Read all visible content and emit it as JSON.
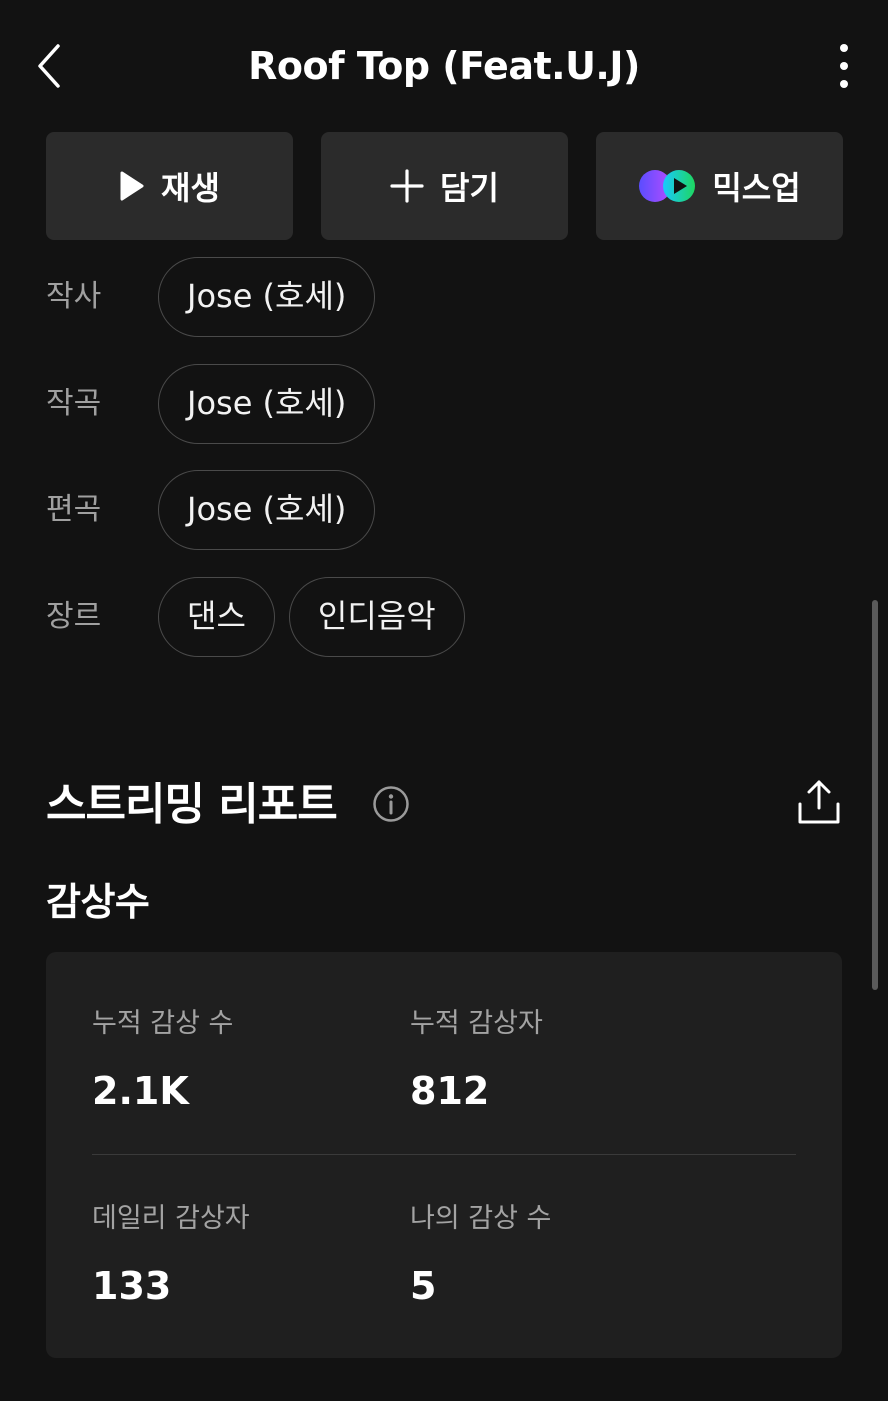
{
  "header": {
    "title": "Roof Top (Feat.U.J)",
    "back_icon": "chevron-left-icon",
    "more_icon": "more-vertical-icon"
  },
  "actions": [
    {
      "label": "재생",
      "icon": "play-icon"
    },
    {
      "label": "담기",
      "icon": "plus-icon"
    },
    {
      "label": "믹스업",
      "icon": "mixup-icon"
    }
  ],
  "credits": {
    "lyricist": {
      "label": "작사",
      "values": [
        "Jose (호세)"
      ]
    },
    "composer": {
      "label": "작곡",
      "values": [
        "Jose (호세)"
      ]
    },
    "arranger": {
      "label": "편곡",
      "values": [
        "Jose (호세)"
      ]
    },
    "genre": {
      "label": "장르",
      "values": [
        "댄스",
        "인디음악"
      ]
    }
  },
  "report": {
    "title": "스트리밍 리포트",
    "info_icon": "info-icon",
    "share_icon": "share-icon",
    "section_title": "감상수",
    "stats": [
      {
        "label": "누적 감상 수",
        "value": "2.1K"
      },
      {
        "label": "누적 감상자",
        "value": "812"
      },
      {
        "label": "데일리 감상자",
        "value": "133"
      },
      {
        "label": "나의 감상 수",
        "value": "5"
      }
    ]
  },
  "colors": {
    "background": "#121212",
    "button_bg": "#2b2b2b",
    "card_bg": "#1f1f1f",
    "label_gray": "#a0a0a0",
    "mixup_green": "#1ed760",
    "mixup_purple": "#7b5cff"
  }
}
